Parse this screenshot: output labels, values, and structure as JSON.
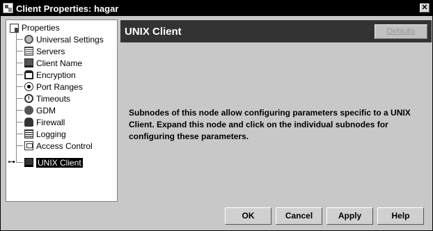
{
  "window": {
    "title": "Client Properties: hagar",
    "close_label": "✕"
  },
  "tree": {
    "root_label": "Properties",
    "items": [
      {
        "label": "Universal Settings",
        "icon": "gear-icon"
      },
      {
        "label": "Servers",
        "icon": "server-icon"
      },
      {
        "label": "Client Name",
        "icon": "monitor-icon"
      },
      {
        "label": "Encryption",
        "icon": "lock-icon"
      },
      {
        "label": "Port Ranges",
        "icon": "port-icon"
      },
      {
        "label": "Timeouts",
        "icon": "clock-icon"
      },
      {
        "label": "GDM",
        "icon": "gdm-icon"
      },
      {
        "label": "Firewall",
        "icon": "firewall-icon"
      },
      {
        "label": "Logging",
        "icon": "log-icon"
      },
      {
        "label": "Access Control",
        "icon": "access-control-icon"
      },
      {
        "label": "UNIX Client",
        "icon": "unix-client-icon",
        "selected": true
      }
    ],
    "expander": "⊶"
  },
  "panel": {
    "title": "UNIX Client",
    "defaults_label": "Defaults",
    "description": "Subnodes of this node allow configuring parameters specific to a UNIX Client. Expand this node and click on the individual subnodes for configuring these parameters."
  },
  "buttons": {
    "ok": "OK",
    "cancel": "Cancel",
    "apply": "Apply",
    "help": "Help"
  },
  "colors": {
    "title_bar": "#000000",
    "header_bar": "#333333",
    "panel_bg": "#c8c8c8",
    "selection": "#000000"
  }
}
